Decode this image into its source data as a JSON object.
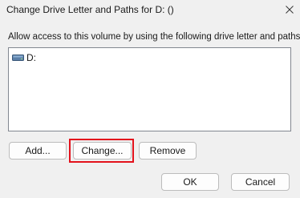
{
  "window": {
    "title": "Change Drive Letter and Paths for D: ()",
    "close_icon": "close-icon"
  },
  "prompt_text": "Allow access to this volume by using the following drive letter and paths:",
  "list": {
    "items": [
      {
        "label": "D:",
        "icon": "drive-icon"
      }
    ]
  },
  "buttons": {
    "add": "Add...",
    "change": "Change...",
    "remove": "Remove",
    "ok": "OK",
    "cancel": "Cancel"
  },
  "annotation": {
    "highlighted_button": "change",
    "highlight_color": "#e3121c"
  }
}
